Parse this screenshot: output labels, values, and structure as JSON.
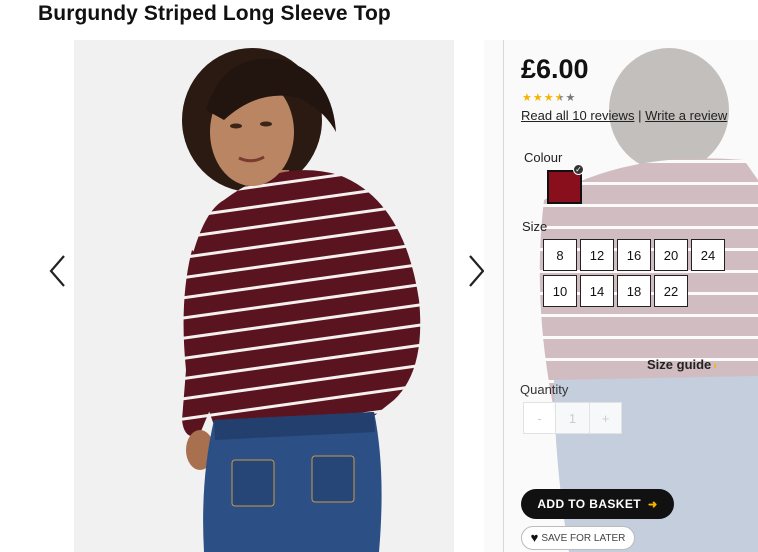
{
  "product": {
    "title": "Burgundy Striped Long Sleeve Top",
    "price": "£6.00",
    "rating": {
      "value": 3.5,
      "max": 5
    },
    "reviews_link": "Read all 10 reviews",
    "separator": "|",
    "write_review": "Write a review"
  },
  "colour": {
    "label": "Colour",
    "selected_hex": "#8a0f1c"
  },
  "size": {
    "label": "Size",
    "options": [
      "8",
      "12",
      "16",
      "20",
      "24",
      "10",
      "14",
      "18",
      "22"
    ]
  },
  "size_guide": {
    "label": "Size guide",
    "icon": "arrow-right-icon"
  },
  "quantity": {
    "label": "Quantity",
    "minus": "-",
    "value": "1",
    "plus": "+"
  },
  "actions": {
    "add_to_basket": "ADD TO BASKET",
    "save_for_later": "SAVE FOR LATER"
  },
  "colors": {
    "accent": "#f5b400",
    "button": "#111111",
    "garment": "#5a1420"
  }
}
